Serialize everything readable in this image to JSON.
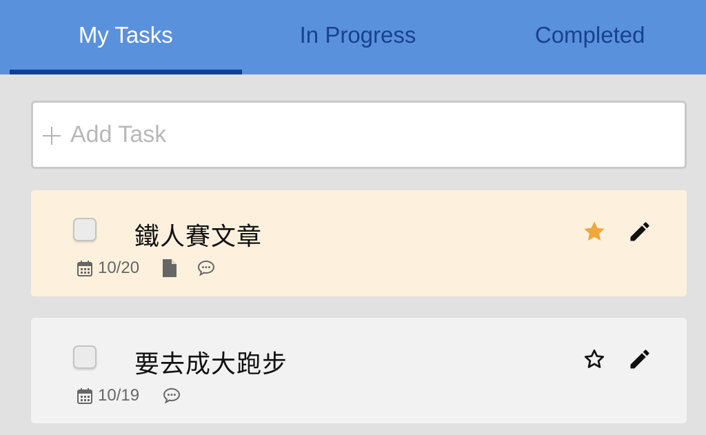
{
  "tabs": [
    {
      "label": "My Tasks",
      "active": true
    },
    {
      "label": "In Progress",
      "active": false
    },
    {
      "label": "Completed",
      "active": false
    }
  ],
  "add_task": {
    "placeholder": "Add Task",
    "icon": "plus-icon"
  },
  "tasks": [
    {
      "title": "鐵人賽文章",
      "date": "10/20",
      "starred": true,
      "has_file": true,
      "has_comment": true,
      "completed": false
    },
    {
      "title": "要去成大跑步",
      "date": "10/19",
      "starred": false,
      "has_file": false,
      "has_comment": true,
      "completed": false
    }
  ],
  "colors": {
    "header_bg": "#5a91dc",
    "tab_active_text": "#ffffff",
    "tab_inactive_text": "#18418f",
    "tab_indicator": "#0e3e96",
    "page_bg": "#e1e1e1",
    "starred_card_bg": "#fdf1de",
    "card_bg": "#f2f2f2",
    "star_filled": "#f0a73b"
  }
}
